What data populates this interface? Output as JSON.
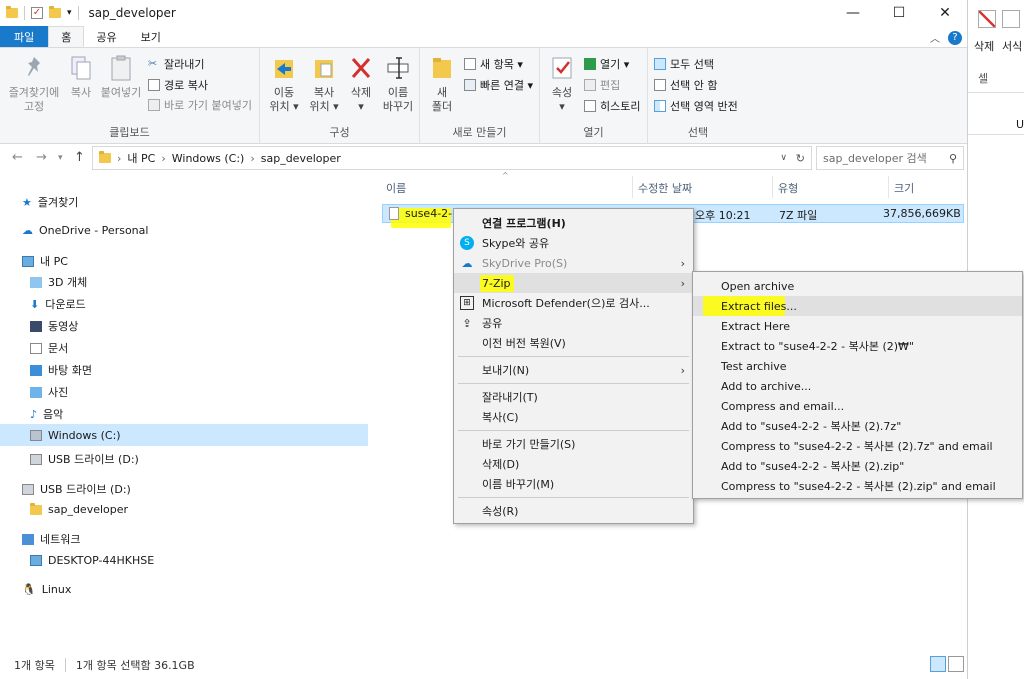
{
  "window": {
    "title": "sap_developer",
    "controls": {
      "minimize": "—",
      "maximize": "☐",
      "close": "✕"
    }
  },
  "ribbon_tabs": [
    {
      "label": "파일"
    },
    {
      "label": "홈"
    },
    {
      "label": "공유"
    },
    {
      "label": "보기"
    }
  ],
  "ribbon": {
    "clipboard": {
      "pin_label_1": "즐겨찾기에",
      "pin_label_2": "고정",
      "copy_label": "복사",
      "paste_label": "붙여넣기",
      "cut_label": "잘라내기",
      "copy_path_label": "경로 복사",
      "paste_shortcut_label": "바로 가기 붙여넣기",
      "group_label": "클립보드"
    },
    "organize": {
      "move_label_1": "이동",
      "move_label_2": "위치 ▾",
      "copyto_label_1": "복사",
      "copyto_label_2": "위치 ▾",
      "delete_label_1": "삭제",
      "delete_label_2": "▾",
      "rename_label_1": "이름",
      "rename_label_2": "바꾸기",
      "group_label": "구성"
    },
    "new": {
      "new_folder_label_1": "새",
      "new_folder_label_2": "폴더",
      "new_item_label": "새 항목 ▾",
      "easy_access_label": "빠른 연결 ▾",
      "group_label": "새로 만들기"
    },
    "open": {
      "properties_label_1": "속성",
      "properties_label_2": "▾",
      "open_label": "열기 ▾",
      "edit_label": "편집",
      "history_label": "히스토리",
      "group_label": "열기"
    },
    "select": {
      "select_all_label": "모두 선택",
      "select_none_label": "선택 안 함",
      "invert_label": "선택 영역 반전",
      "group_label": "선택"
    }
  },
  "address": {
    "path": [
      "내 PC",
      "Windows (C:)",
      "sap_developer"
    ],
    "search_placeholder": "sap_developer 검색"
  },
  "nav_pane": {
    "items": [
      {
        "label": "즐겨찾기"
      },
      {
        "label": "OneDrive - Personal"
      },
      {
        "label": "내 PC"
      },
      {
        "label": "3D 개체"
      },
      {
        "label": "다운로드"
      },
      {
        "label": "동영상"
      },
      {
        "label": "문서"
      },
      {
        "label": "바탕 화면"
      },
      {
        "label": "사진"
      },
      {
        "label": "음악"
      },
      {
        "label": "Windows (C:)"
      },
      {
        "label": "USB 드라이브 (D:)"
      },
      {
        "label": "USB 드라이브 (D:)"
      },
      {
        "label": "sap_developer"
      },
      {
        "label": "네트워크"
      },
      {
        "label": "DESKTOP-44HKHSE"
      },
      {
        "label": "Linux"
      }
    ]
  },
  "file_list": {
    "columns": [
      "이름",
      "수정한 날짜",
      "유형",
      "크기"
    ],
    "rows": [
      {
        "name": "suse4-2-2",
        "modified": "오후 10:21",
        "type": "7Z 파일",
        "size": "37,856,669KB"
      }
    ]
  },
  "context_menu": {
    "items": [
      {
        "label": "연결 프로그램(H)"
      },
      {
        "label": "Skype와 공유"
      },
      {
        "label": "SkyDrive Pro(S)"
      },
      {
        "label": "7-Zip"
      },
      {
        "label": "Microsoft Defender(으)로 검사..."
      },
      {
        "label": "공유"
      },
      {
        "label": "이전 버전 복원(V)"
      },
      {
        "label": "보내기(N)"
      },
      {
        "label": "잘라내기(T)"
      },
      {
        "label": "복사(C)"
      },
      {
        "label": "바로 가기 만들기(S)"
      },
      {
        "label": "삭제(D)"
      },
      {
        "label": "이름 바꾸기(M)"
      },
      {
        "label": "속성(R)"
      }
    ]
  },
  "submenu_7zip": {
    "items": [
      {
        "label": "Open archive"
      },
      {
        "label": "Extract files..."
      },
      {
        "label": "Extract Here"
      },
      {
        "label": "Extract to \"suse4-2-2 - 복사본 (2)₩\""
      },
      {
        "label": "Test archive"
      },
      {
        "label": "Add to archive..."
      },
      {
        "label": "Compress and email..."
      },
      {
        "label": "Add to \"suse4-2-2 - 복사본 (2).7z\""
      },
      {
        "label": "Compress to \"suse4-2-2 - 복사본 (2).7z\" and email"
      },
      {
        "label": "Add to \"suse4-2-2 - 복사본 (2).zip\""
      },
      {
        "label": "Compress to \"suse4-2-2 - 복사본 (2).zip\" and email"
      }
    ]
  },
  "status": {
    "count": "1개 항목",
    "selected": "1개 항목 선택함 36.1GB"
  },
  "background_app": {
    "delete_label": "삭제",
    "format_label": "서식",
    "cell_label": "셀",
    "col_label": "U"
  },
  "colors": {
    "accent": "#1979ca",
    "selection": "#cce8ff",
    "highlight": "#ffff00"
  }
}
